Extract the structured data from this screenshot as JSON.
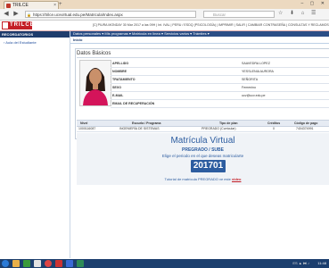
{
  "browser": {
    "tab_title": "TRILCE",
    "tab_close": "×",
    "new_tab": "+",
    "window_buttons": "– ▢ ✕",
    "url": "https://trilce.ucvvirtual.edu.pe/Matricula/Index.aspx",
    "search_placeholder": "Buscar",
    "back_icon": "back-arrow-icon",
    "forward_icon": "forward-arrow-icon",
    "toolbar_icons": "☆ ⬇ ⌂ ☰"
  },
  "header": {
    "logo": "TRILCE",
    "info": "[C] PIURA MONDAY 30 Mar 2017 a las 09H | Int. IVAL | PERU / ESDQ (PSICOLOGÍA) | IMPRIMIR | SALIR | CAMBIAR CONTRASEÑA | CONSULTAS Y RECLAMOS"
  },
  "sidebar": {
    "heading": "RECORDATORIOS",
    "item": "Aula del Estudiante"
  },
  "menubar": {
    "items": "Datos personales ▾   Mis programas ▾   Matrícula en línea ▾   Servicios varios ▾   Trámites ▾"
  },
  "breadcrumb": "Inicio",
  "datos": {
    "title": "Datos Básicos",
    "rows": [
      {
        "label": "APELLIDO",
        "value": "SAAVEDRA LOPEZ"
      },
      {
        "label": "NOMBRE",
        "value": "YESSLENIA AURORA"
      },
      {
        "label": "TRATAMIENTO",
        "value": "SEÑORITA"
      },
      {
        "label": "SEXO",
        "value": "Femenino"
      },
      {
        "label": "E-MAIL",
        "value": "ucv@ucv.edu.pe"
      },
      {
        "label": "EMAIL DE RECUPERACIÓN",
        "value": ""
      }
    ]
  },
  "programs": {
    "headers": [
      "Nivel",
      "Escuela / Programa",
      "Tipo de plan",
      "Créditos",
      "Código de pago"
    ],
    "row": [
      "1000116087",
      "INGENIERÍA DE SISTEMAS",
      "PREGRADO (Curricular)",
      "0",
      "7404374991"
    ]
  },
  "matricula": {
    "title": "Matrícula Virtual",
    "subtitle": "PREGRADO / SUBE",
    "description": "Elige el periodo en el que deseas matricularte",
    "period": "201701",
    "tutorial_text": "Tutorial de matrícula PREGRADO ve este",
    "tutorial_link": "video"
  },
  "taskbar": {
    "tray": "ES ▲ ⧓ ♪",
    "clock": "11:48"
  },
  "colors": {
    "brand_red": "#c41f27",
    "nav_blue": "#2b4e86",
    "accent_blue": "#2d5da0"
  }
}
